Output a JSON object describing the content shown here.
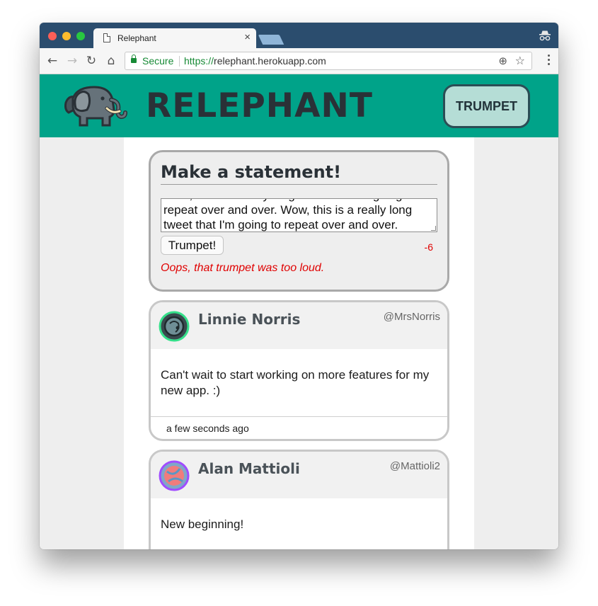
{
  "browser": {
    "tab_title": "Relephant",
    "tab_close": "×",
    "secure_label": "Secure",
    "url_scheme": "https://",
    "url_host": "relephant.herokuapp.com"
  },
  "header": {
    "title": "RELEPHANT",
    "nav_button": "TRUMPET"
  },
  "composer": {
    "title": "Make a statement!",
    "input_value": "Wow, this is a really long tweet that I'm going to repeat over and over. Wow, this is a really long tweet that I'm going to repeat over and over.",
    "submit_label": "Trumpet!",
    "char_count": "-6",
    "error": "Oops, that trumpet was too loud."
  },
  "posts": [
    {
      "author": "Linnie Norris",
      "handle": "@MrsNorris",
      "body": "Can't wait to start working on more features for my new app. :)",
      "time": "a few seconds ago",
      "avatar_ring": "#35e08a"
    },
    {
      "author": "Alan Mattioli",
      "handle": "@Mattioli2",
      "body": "New beginning!",
      "avatar_ring": "#a04cff"
    }
  ],
  "colors": {
    "header_bg": "#00a389",
    "error": "#e00000",
    "nav_button_bg": "#b5ddd6"
  }
}
